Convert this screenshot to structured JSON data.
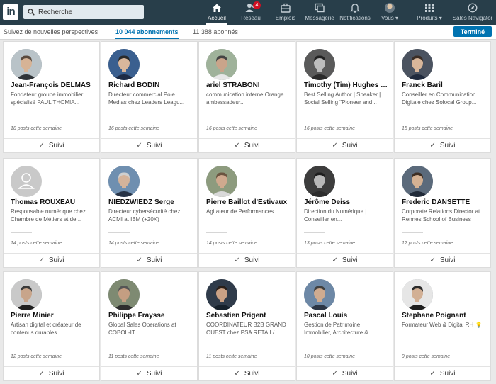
{
  "nav": {
    "logo": "in",
    "search_placeholder": "Recherche",
    "items": [
      {
        "key": "home",
        "label": "Accueil",
        "icon": "home-icon",
        "active": true
      },
      {
        "key": "network",
        "label": "Réseau",
        "icon": "network-icon",
        "badge": "4"
      },
      {
        "key": "jobs",
        "label": "Emplois",
        "icon": "briefcase-icon"
      },
      {
        "key": "messaging",
        "label": "Messagerie",
        "icon": "chat-icon"
      },
      {
        "key": "notifications",
        "label": "Notifications",
        "icon": "bell-icon"
      },
      {
        "key": "me",
        "label": "Vous ▾",
        "icon": "profile-avatar"
      },
      {
        "key": "products",
        "label": "Produits ▾",
        "icon": "grid-icon"
      },
      {
        "key": "sales",
        "label": "Sales Navigator",
        "icon": "compass-icon"
      }
    ]
  },
  "subnav": {
    "perspectives": "Suivez de nouvelles perspectives",
    "following": "10 044 abonnements",
    "followers": "11 388 abonnés",
    "done": "Terminé"
  },
  "follow_label": "Suivi",
  "rows": [
    [
      {
        "name": "Jean-François DELMAS",
        "headline": "Fondateur groupe immobilier spécialisé PAUL THOMIA...",
        "posts": "18 posts cette semaine",
        "skin": "#d6b396",
        "bg": "#b9c3c8",
        "hair": "#5a4a3e",
        "suit": "#2e3338"
      },
      {
        "name": "Richard BODIN",
        "headline": "Directeur commercial Pole Medias chez Leaders Leagu...",
        "posts": "16 posts cette semaine",
        "skin": "#d9b79c",
        "bg": "#3a5f8f",
        "hair": "#2a2a2a",
        "suit": "#1d2b46"
      },
      {
        "name": "ariel STRABONI",
        "headline": "communication interne Orange ambassadeur...",
        "posts": "16 posts cette semaine",
        "skin": "#c9a48a",
        "bg": "#9fb29a",
        "hair": "#444",
        "suit": "#e7e7e7"
      },
      {
        "name": "Timothy (Tim) Hughes 提姆·休斯",
        "headline": "Best Selling Author | Speaker | Social Selling \"Pioneer and...",
        "posts": "16 posts cette semaine",
        "skin": "#bdbdbd",
        "bg": "#5a5a5a",
        "hair": "#222",
        "suit": "#2a2a2a"
      },
      {
        "name": "Franck Baril",
        "headline": "Conseiller en Communication Digitale chez Solocal Group...",
        "posts": "15 posts cette semaine",
        "skin": "#d8b69a",
        "bg": "#4b5360",
        "hair": "#3a2d25",
        "suit": "#1f2a3d"
      }
    ],
    [
      {
        "name": "Thomas ROUXEAU",
        "headline": "Responsable numérique chez Chambre de Métiers et de...",
        "posts": "14 posts cette semaine",
        "placeholder": true
      },
      {
        "name": "NIEDZWIEDZ Serge",
        "headline": "Directeur cybersécurité chez ACMI at IBM (+20K)",
        "posts": "14 posts cette semaine",
        "skin": "#d4b39b",
        "bg": "#6f8fb0",
        "hair": "#cfcfcf",
        "suit": "#283447"
      },
      {
        "name": "Pierre Baillot d'Estivaux",
        "headline": "Agitateur de Performances",
        "posts": "14 posts cette semaine",
        "skin": "#cfa98e",
        "bg": "#8d9b7e",
        "hair": "#6b5440",
        "suit": "#d9d9d9"
      },
      {
        "name": "Jérôme Deiss",
        "headline": "Direction du Numérique | Conseiller en...",
        "posts": "13 posts cette semaine",
        "skin": "#b8b8b8",
        "bg": "#3d3d3d",
        "hair": "#1e1e1e",
        "suit": "#2e2e2e"
      },
      {
        "name": "Frederic DANSETTE",
        "headline": "Corporate Relations Director at Rennes School of Business",
        "posts": "12 posts cette semaine",
        "skin": "#d4b193",
        "bg": "#5b6a7b",
        "hair": "#3d2e23",
        "suit": "#202a38"
      }
    ],
    [
      {
        "name": "Pierre Minier",
        "headline": "Artisan digital et créateur de contenus durables",
        "posts": "12 posts cette semaine",
        "skin": "#c8a58b",
        "bg": "#c9c9c9",
        "hair": "#3a3a3a",
        "suit": "#1f1f1f"
      },
      {
        "name": "Philippe Fraysse",
        "headline": "Global Sales Operations at COBOL-IT",
        "posts": "11 posts cette semaine",
        "skin": "#c49e82",
        "bg": "#7e8a72",
        "hair": "#555",
        "suit": "#2d2d2d"
      },
      {
        "name": "Sebastien Prigent",
        "headline": "COORDINATEUR B2B GRAND OUEST chez PSA RETAIL/...",
        "posts": "11 posts cette semaine",
        "skin": "#c9a185",
        "bg": "#2f3b4a",
        "hair": "#2a201a",
        "suit": "#15202b"
      },
      {
        "name": "Pascal Louis",
        "headline": "Gestion de Patrimoine Immobilier, Architecture &...",
        "posts": "10 posts cette semaine",
        "skin": "#cfab90",
        "bg": "#6d88a6",
        "hair": "#3f3f3f",
        "suit": "#2b3545"
      },
      {
        "name": "Stephane Poignant",
        "headline": "Formateur Web & Digital RH 💡",
        "posts": "9 posts cette semaine",
        "skin": "#d2b095",
        "bg": "#e6e6e6",
        "hair": "#2a2a2a",
        "suit": "#1e1e1e"
      }
    ]
  ]
}
